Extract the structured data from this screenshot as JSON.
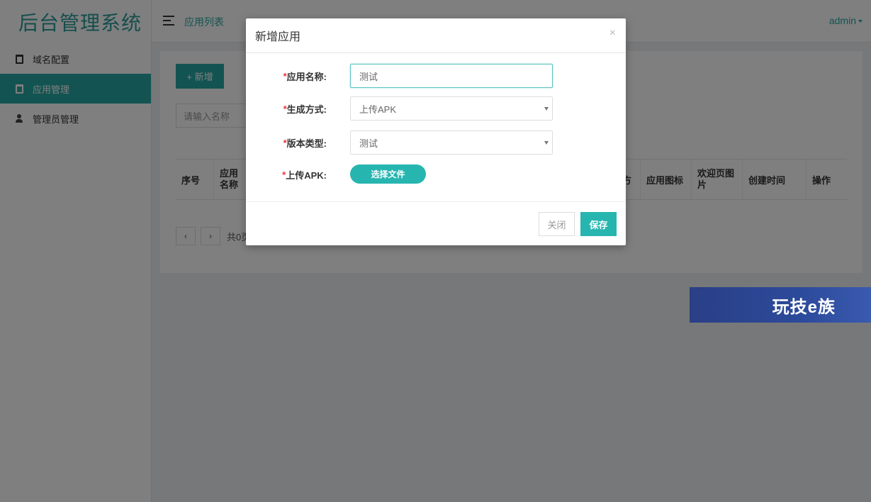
{
  "app": {
    "title": "后台管理系统"
  },
  "sidebar": {
    "items": [
      {
        "label": "域名配置",
        "icon": "clipboard-icon",
        "active": false
      },
      {
        "label": "应用管理",
        "icon": "clipboard-icon",
        "active": true
      },
      {
        "label": "管理员管理",
        "icon": "user-icon",
        "active": false
      }
    ]
  },
  "header": {
    "breadcrumb": "应用列表",
    "user": "admin"
  },
  "main": {
    "new_button": "+ 新增",
    "search_placeholder": "请输入名称",
    "table_headers": [
      "序号",
      "应用名称",
      "方",
      "应用图标",
      "欢迎页图片",
      "创建时间",
      "操作"
    ],
    "pager": {
      "prev": "‹",
      "next": "›",
      "info": "共0页"
    }
  },
  "modal": {
    "title": "新增应用",
    "close_glyph": "×",
    "fields": {
      "app_name": {
        "required": "*",
        "label": "应用名称:",
        "value": "测试"
      },
      "gen_mode": {
        "required": "*",
        "label": "生成方式:",
        "value": "上传APK"
      },
      "version_type": {
        "required": "*",
        "label": "版本类型:",
        "value": "测试"
      },
      "upload": {
        "required": "*",
        "label": "上传APK:",
        "button": "选择文件"
      }
    },
    "footer": {
      "close": "关闭",
      "save": "保存"
    }
  },
  "watermark": {
    "text": "玩技e族"
  },
  "colors": {
    "accent": "#27a9a5",
    "button": "#27b5b0",
    "required": "#e33333",
    "banner": "#2a3f86"
  }
}
